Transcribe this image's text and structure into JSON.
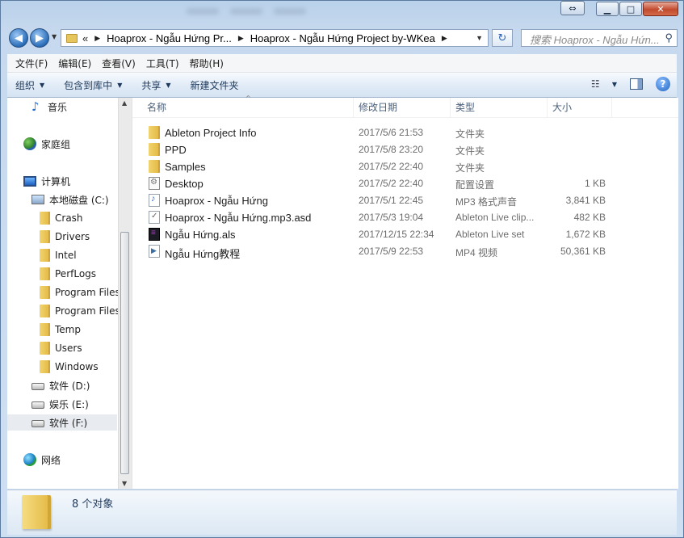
{
  "window": {
    "caption_buttons": {
      "minimize": "▁",
      "maximize": "□",
      "close": "✕",
      "mirror": "⇔"
    }
  },
  "nav": {
    "back_icon": "arrow-left-icon",
    "forward_icon": "arrow-right-icon",
    "address": {
      "overflow": "«",
      "crumbs": [
        "Hoaprox - Ngẫu Hứng Pr...",
        "Hoaprox - Ngẫu Hứng Project by-WKea"
      ]
    },
    "search_placeholder": "搜索 Hoaprox - Ngẫu Hứn..."
  },
  "menubar": [
    "文件(F)",
    "编辑(E)",
    "查看(V)",
    "工具(T)",
    "帮助(H)"
  ],
  "toolbar": {
    "organize": "组织",
    "include_in_library": "包含到库中",
    "share": "共享",
    "new_folder": "新建文件夹"
  },
  "navpane": {
    "items": [
      {
        "label": "音乐",
        "icon": "music-icon"
      },
      {
        "label": "家庭组",
        "icon": "homegroup-icon"
      },
      {
        "label": "计算机",
        "icon": "computer-icon"
      },
      {
        "label": "本地磁盘 (C:)",
        "icon": "system-drive-icon"
      },
      {
        "label": "Crash",
        "icon": "folder-icon"
      },
      {
        "label": "Drivers",
        "icon": "folder-icon"
      },
      {
        "label": "Intel",
        "icon": "folder-icon"
      },
      {
        "label": "PerfLogs",
        "icon": "folder-icon"
      },
      {
        "label": "Program Files",
        "icon": "folder-icon"
      },
      {
        "label": "Program Files",
        "icon": "folder-icon"
      },
      {
        "label": "Temp",
        "icon": "folder-icon"
      },
      {
        "label": "Users",
        "icon": "folder-icon"
      },
      {
        "label": "Windows",
        "icon": "folder-icon"
      },
      {
        "label": "软件 (D:)",
        "icon": "drive-icon"
      },
      {
        "label": "娱乐 (E:)",
        "icon": "drive-icon"
      },
      {
        "label": "软件 (F:)",
        "icon": "drive-icon"
      },
      {
        "label": "网络",
        "icon": "network-icon"
      }
    ]
  },
  "files": {
    "columns": {
      "name": "名称",
      "date": "修改日期",
      "type": "类型",
      "size": "大小"
    },
    "rows": [
      {
        "name": "Ableton Project Info",
        "date": "2017/5/6 21:53",
        "type": "文件夹",
        "size": "",
        "icon": "folder-icon"
      },
      {
        "name": "PPD",
        "date": "2017/5/8 23:20",
        "type": "文件夹",
        "size": "",
        "icon": "folder-icon"
      },
      {
        "name": "Samples",
        "date": "2017/5/2 22:40",
        "type": "文件夹",
        "size": "",
        "icon": "folder-icon"
      },
      {
        "name": "Desktop",
        "date": "2017/5/2 22:40",
        "type": "配置设置",
        "size": "1 KB",
        "icon": "settings-file-icon"
      },
      {
        "name": "Hoaprox - Ngẫu Hứng",
        "date": "2017/5/1 22:45",
        "type": "MP3 格式声音",
        "size": "3,841 KB",
        "icon": "audio-file-icon"
      },
      {
        "name": "Hoaprox - Ngẫu Hứng.mp3.asd",
        "date": "2017/5/3 19:04",
        "type": "Ableton Live clip...",
        "size": "482 KB",
        "icon": "ableton-clip-icon"
      },
      {
        "name": "Ngẫu Hứng.als",
        "date": "2017/12/15 22:34",
        "type": "Ableton Live set",
        "size": "1,672 KB",
        "icon": "ableton-set-icon"
      },
      {
        "name": "Ngẫu Hứng教程",
        "date": "2017/5/9 22:53",
        "type": "MP4 视频",
        "size": "50,361 KB",
        "icon": "video-file-icon"
      }
    ]
  },
  "status": {
    "count": "8 个对象"
  }
}
